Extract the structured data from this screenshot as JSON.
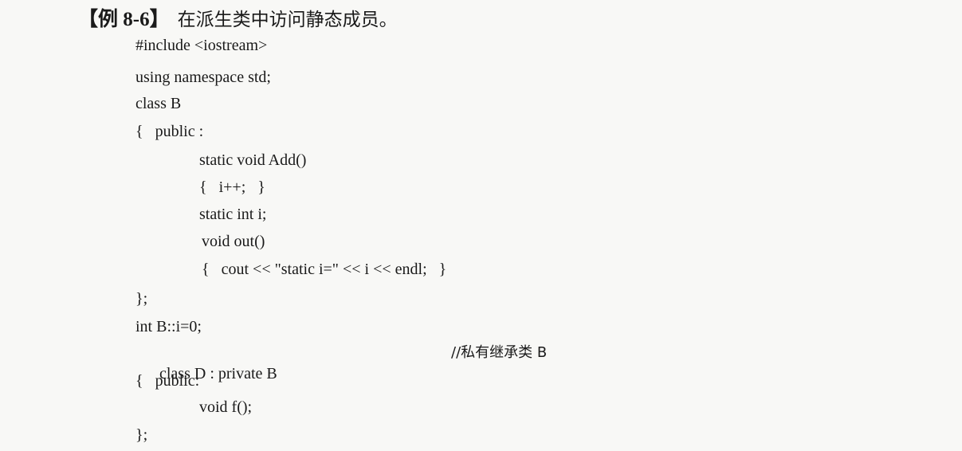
{
  "heading": {
    "label": "【例 8-6】",
    "title": "在派生类中访问静态成员。"
  },
  "code": {
    "lines": [
      "#include <iostream>",
      "using namespace std;",
      "class B",
      "{   public :",
      "static void Add()",
      "{   i++;   }",
      "static int i;",
      "void out()",
      "{   cout << \"static i=\" << i << endl;   }",
      "};",
      "int B::i=0;",
      "class D : private B",
      "{   public:",
      "void f();",
      "};"
    ],
    "comment": "//私有继承类 B"
  }
}
